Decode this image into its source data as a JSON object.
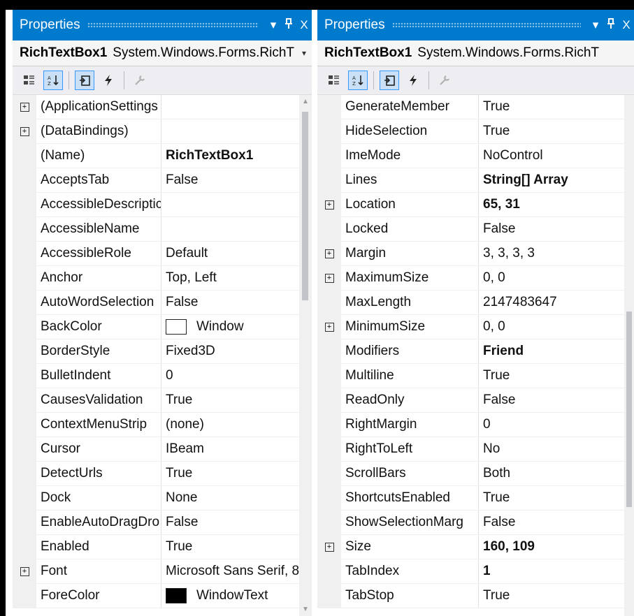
{
  "left_panel": {
    "title": "Properties",
    "pin": "ȉ",
    "close": "X",
    "dropdown_arrow": "▾",
    "object_name": "RichTextBox1",
    "object_type": "System.Windows.Forms.RichT",
    "selector_arrow": "▾",
    "toolbar_icons": [
      "categorized-icon",
      "alphabetical-icon",
      "properties-icon",
      "events-icon",
      "property-pages-icon"
    ],
    "rows": [
      {
        "name": "(ApplicationSettings",
        "value": "",
        "expandable": true
      },
      {
        "name": "(DataBindings)",
        "value": "",
        "expandable": true
      },
      {
        "name": "(Name)",
        "value": "RichTextBox1",
        "bold": true
      },
      {
        "name": "AcceptsTab",
        "value": "False"
      },
      {
        "name": "AccessibleDescriptic",
        "value": ""
      },
      {
        "name": "AccessibleName",
        "value": ""
      },
      {
        "name": "AccessibleRole",
        "value": "Default"
      },
      {
        "name": "Anchor",
        "value": "Top, Left"
      },
      {
        "name": "AutoWordSelection",
        "value": "False"
      },
      {
        "name": "BackColor",
        "value": "Window",
        "swatch": "#ffffff"
      },
      {
        "name": "BorderStyle",
        "value": "Fixed3D"
      },
      {
        "name": "BulletIndent",
        "value": "0"
      },
      {
        "name": "CausesValidation",
        "value": "True"
      },
      {
        "name": "ContextMenuStrip",
        "value": "(none)"
      },
      {
        "name": "Cursor",
        "value": "IBeam"
      },
      {
        "name": "DetectUrls",
        "value": "True"
      },
      {
        "name": "Dock",
        "value": "None"
      },
      {
        "name": "EnableAutoDragDro",
        "value": "False"
      },
      {
        "name": "Enabled",
        "value": "True"
      },
      {
        "name": "Font",
        "value": "Microsoft Sans Serif, 8",
        "expandable": true
      },
      {
        "name": "ForeColor",
        "value": "WindowText",
        "swatch": "#000000"
      }
    ]
  },
  "right_panel": {
    "title": "Properties",
    "pin": "ȉ",
    "close": "X",
    "dropdown_arrow": "▾",
    "object_name": "RichTextBox1",
    "object_type": "System.Windows.Forms.RichT",
    "toolbar_icons": [
      "categorized-icon",
      "alphabetical-icon",
      "properties-icon",
      "events-icon",
      "property-pages-icon"
    ],
    "rows": [
      {
        "name": "GenerateMember",
        "value": "True"
      },
      {
        "name": "HideSelection",
        "value": "True"
      },
      {
        "name": "ImeMode",
        "value": "NoControl"
      },
      {
        "name": "Lines",
        "value": "String[] Array",
        "bold": true
      },
      {
        "name": "Location",
        "value": "65, 31",
        "bold": true,
        "expandable": true
      },
      {
        "name": "Locked",
        "value": "False"
      },
      {
        "name": "Margin",
        "value": "3, 3, 3, 3",
        "expandable": true
      },
      {
        "name": "MaximumSize",
        "value": "0, 0",
        "expandable": true
      },
      {
        "name": "MaxLength",
        "value": "2147483647"
      },
      {
        "name": "MinimumSize",
        "value": "0, 0",
        "expandable": true
      },
      {
        "name": "Modifiers",
        "value": "Friend",
        "bold": true
      },
      {
        "name": "Multiline",
        "value": "True"
      },
      {
        "name": "ReadOnly",
        "value": "False"
      },
      {
        "name": "RightMargin",
        "value": "0"
      },
      {
        "name": "RightToLeft",
        "value": "No"
      },
      {
        "name": "ScrollBars",
        "value": "Both"
      },
      {
        "name": "ShortcutsEnabled",
        "value": "True"
      },
      {
        "name": "ShowSelectionMarg",
        "value": "False"
      },
      {
        "name": "Size",
        "value": "160, 109",
        "bold": true,
        "expandable": true
      },
      {
        "name": "TabIndex",
        "value": "1",
        "bold": true
      },
      {
        "name": "TabStop",
        "value": "True"
      }
    ]
  },
  "colors": {
    "title_bg": "#007acc",
    "panel_bg": "#eeeef2"
  }
}
